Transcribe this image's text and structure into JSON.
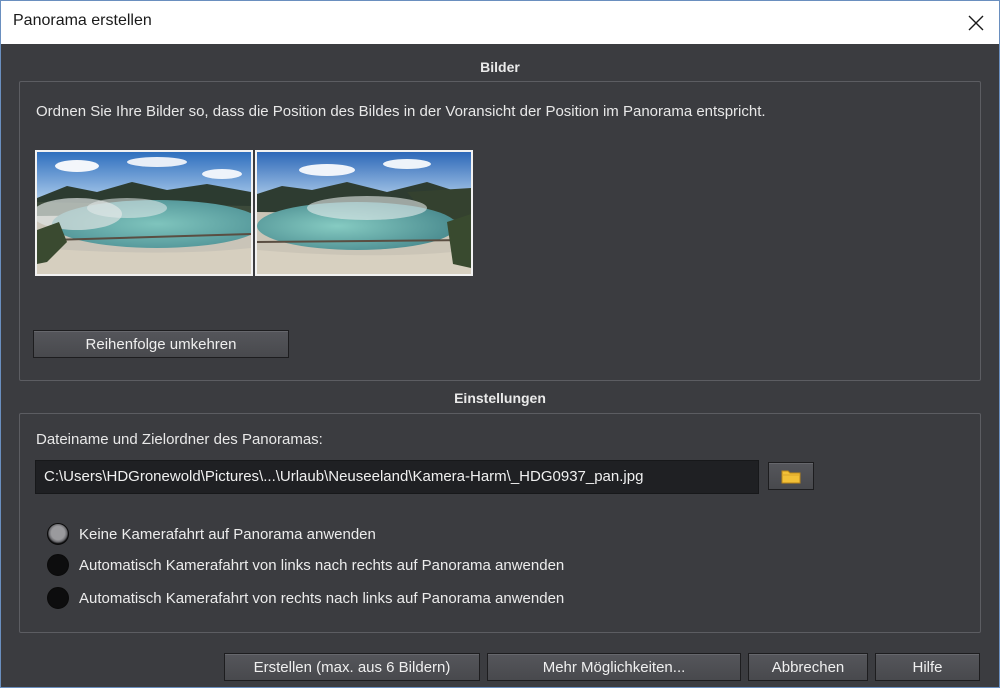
{
  "window": {
    "title": "Panorama erstellen"
  },
  "sections": {
    "images_title": "Bilder",
    "settings_title": "Einstellungen"
  },
  "images": {
    "hint": "Ordnen Sie Ihre Bilder so, dass die Position des Bildes in der Voransicht der Position im Panorama entspricht.",
    "thumbnails": [
      "panorama-thumbnail-1",
      "panorama-thumbnail-2"
    ],
    "reverse_label": "Reihenfolge umkehren"
  },
  "settings": {
    "path_label": "Dateiname und Zielordner des Panoramas:",
    "path_value": "C:\\Users\\HDGronewold\\Pictures\\...\\Urlaub\\Neuseeland\\Kamera-Harm\\_HDG0937_pan.jpg",
    "browse_icon": "folder-icon",
    "options": [
      {
        "label": "Keine Kamerafahrt auf Panorama anwenden",
        "checked": true
      },
      {
        "label": "Automatisch Kamerafahrt von links nach rechts auf Panorama anwenden",
        "checked": false
      },
      {
        "label": "Automatisch Kamerafahrt von rechts nach links auf Panorama anwenden",
        "checked": false
      }
    ]
  },
  "footer": {
    "create": "Erstellen (max. aus 6 Bildern)",
    "more": "Mehr Möglichkeiten...",
    "cancel": "Abbrechen",
    "help": "Hilfe"
  },
  "colors": {
    "background": "#3b3c40",
    "titlebar": "#ffffff",
    "field": "#1f2023",
    "folder": "#f2c037"
  }
}
